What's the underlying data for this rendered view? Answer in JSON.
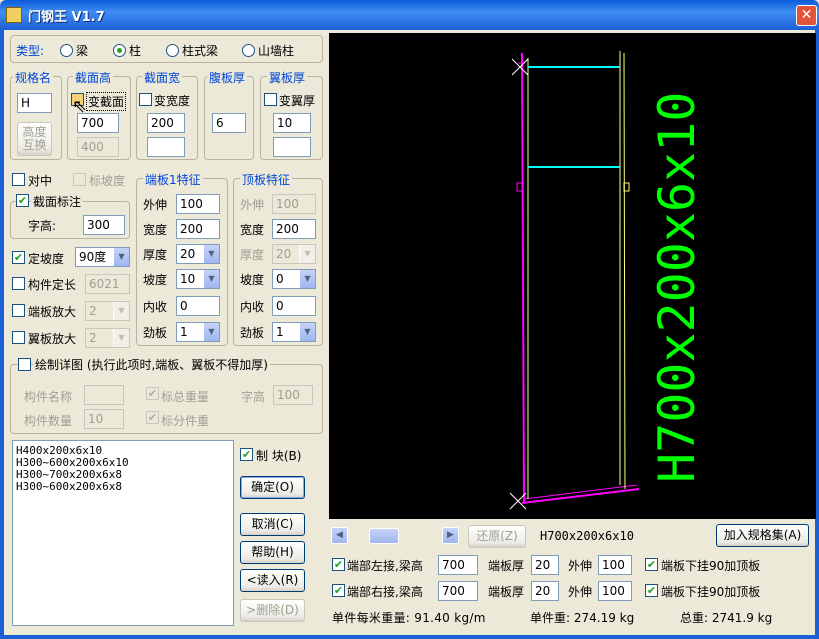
{
  "window": {
    "title": "门钢王 V1.7",
    "close": "✕"
  },
  "type_row": {
    "label": "类型:",
    "options": [
      "梁",
      "柱",
      "柱式梁",
      "山墙柱"
    ],
    "selected": 1
  },
  "spec": {
    "name_header": "规格名",
    "name_value": "H",
    "swap_btn_l1": "高度",
    "swap_btn_l2": "互换",
    "height_header": "截面高",
    "var_section": "变截面",
    "height1": "700",
    "height2": "400",
    "width_header": "截面宽",
    "var_width": "变宽度",
    "width1": "200",
    "width2": "",
    "web_header": "腹板厚",
    "web_value": "6",
    "flange_header": "翼板厚",
    "var_flange": "变翼厚",
    "flange1": "10",
    "flange2": ""
  },
  "opts": {
    "center": "对中",
    "mark_slope": "标坡度",
    "section_mark": "截面标注",
    "font_h_label": "字高:",
    "font_h_value": "300",
    "fixed_slope": "定坡度",
    "fixed_slope_value": "90度",
    "fixed_len": "构件定长",
    "fixed_len_value": "6021",
    "end_enlarge": "端板放大",
    "end_enlarge_value": "2",
    "wing_enlarge": "翼板放大",
    "wing_enlarge_value": "2"
  },
  "end1": {
    "title": "端板1特征",
    "labels": [
      "外伸",
      "宽度",
      "厚度",
      "坡度",
      "内收",
      "劲板"
    ],
    "values": [
      "100",
      "200",
      "20",
      "10",
      "0",
      "1"
    ]
  },
  "top": {
    "title": "顶板特征",
    "labels": [
      "外伸",
      "宽度",
      "厚度",
      "坡度",
      "内收",
      "劲板"
    ],
    "values": [
      "100",
      "200",
      "20",
      "0",
      "0",
      "1"
    ]
  },
  "detail": {
    "title": "绘制详图 (执行此项时,端板、翼板不得加厚)",
    "name_label": "构件名称",
    "name_value": "",
    "total_weight": "标总重量",
    "font_label": "字高",
    "font_value": "100",
    "qty_label": "构件数量",
    "qty_value": "10",
    "part_weight": "标分件重"
  },
  "list": {
    "items": [
      "H400x200x6x10",
      "H300~600x200x6x10",
      "H300~700x200x6x8",
      "H300~600x200x6x8"
    ]
  },
  "buttons": {
    "block": "制  块(B)",
    "ok": "确定(O)",
    "cancel": "取消(C)",
    "help": "帮助(H)",
    "load": "<读入(R)",
    "delete": ">删除(D)"
  },
  "canvas": {
    "section_text": "H700x200x6x10",
    "colors": {
      "web": "#ff00ff",
      "flange": "#ffff80",
      "stiff": "#00ffff",
      "text": "#00ff00"
    }
  },
  "status": {
    "restore": "还原(Z)",
    "spec": "H700x200x6x10",
    "add_spec": "加入规格集(A)"
  },
  "conn_left": {
    "label": "端部左接,梁高",
    "beam_h": "700",
    "plate_t_label": "端板厚",
    "plate_t": "20",
    "ext_label": "外伸",
    "ext": "100",
    "hang": "端板下挂90加顶板"
  },
  "conn_right": {
    "label": "端部右接,梁高",
    "beam_h": "700",
    "plate_t_label": "端板厚",
    "plate_t": "20",
    "ext_label": "外伸",
    "ext": "100",
    "hang": "端板下挂90加顶板"
  },
  "weights": {
    "per_m": "单件每米重量: 91.40 kg/m",
    "single": "单件重: 274.19 kg",
    "total": "总重: 2741.9 kg"
  }
}
